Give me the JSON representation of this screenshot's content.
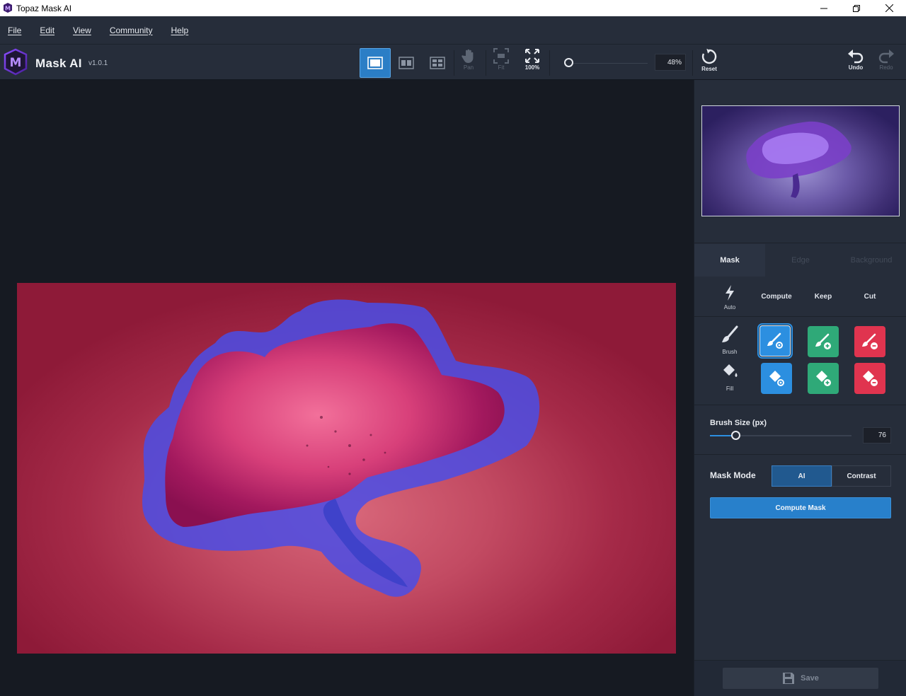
{
  "window": {
    "title": "Topaz Mask AI"
  },
  "menu": {
    "items": [
      "File",
      "Edit",
      "View",
      "Community",
      "Help"
    ]
  },
  "toolbar": {
    "app_name": "Mask AI",
    "version": "v1.0.1",
    "pan_label": "Pan",
    "fit_label": "Fit",
    "zoom100_label": "100%",
    "zoom_value": "48%",
    "zoom_fraction": 0.0,
    "reset_label": "Reset",
    "undo_label": "Undo",
    "redo_label": "Redo"
  },
  "panel": {
    "tabs": [
      "Mask",
      "Edge",
      "Background"
    ],
    "active_tab": "Mask",
    "auto_label": "Auto",
    "compute_label": "Compute",
    "keep_label": "Keep",
    "cut_label": "Cut",
    "brush_label": "Brush",
    "fill_label": "Fill",
    "brush_size_label": "Brush Size (px)",
    "brush_size_value": "76",
    "brush_size_fraction": 0.18,
    "mask_mode_label": "Mask Mode",
    "mode_ai": "AI",
    "mode_contrast": "Contrast",
    "compute_mask_label": "Compute Mask",
    "save_label": "Save"
  },
  "colors": {
    "compute": "#2c8fe0",
    "keep": "#2fa978",
    "cut": "#e0344f",
    "accent": "#2880cb",
    "overlay": "#4a4de6"
  }
}
